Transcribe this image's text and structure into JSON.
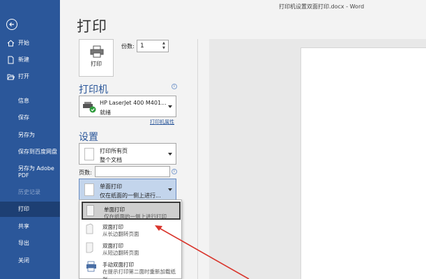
{
  "window": {
    "title": "打印机设置双面打印.docx  -  Word"
  },
  "sidebar": {
    "back_label": "",
    "items": [
      {
        "label": "开始"
      },
      {
        "label": "新建"
      },
      {
        "label": "打开"
      },
      {
        "label": "信息"
      },
      {
        "label": "保存"
      },
      {
        "label": "另存为"
      },
      {
        "label": "保存到百度网盘"
      },
      {
        "label_line1": "另存为 Adobe",
        "label_line2": "PDF"
      },
      {
        "label": "历史记录"
      },
      {
        "label": "打印"
      },
      {
        "label": "共享"
      },
      {
        "label": "导出"
      },
      {
        "label": "关闭"
      }
    ]
  },
  "main": {
    "title": "打印",
    "print_button": "打印",
    "copies_label": "份数:",
    "copies_value": "1",
    "printer_heading": "打印机",
    "printer_name": "HP LaserJet 400 M401...",
    "printer_status": "就绪",
    "printer_properties": "打印机属性",
    "settings_heading": "设置",
    "print_range_line1": "打印所有页",
    "print_range_line2": "整个文档",
    "pages_label": "页数:",
    "pages_value": "",
    "duplex_line1": "单面打印",
    "duplex_line2": "仅在纸面的一侧上进行...",
    "options": [
      {
        "t1": "单面打印",
        "t2": "仅在纸面的一侧上进行打印"
      },
      {
        "t1": "双面打印",
        "t2": "从长边翻转页面"
      },
      {
        "t1": "双面打印",
        "t2": "从短边翻转页面"
      },
      {
        "t1": "手动双面打印",
        "t2": "在提示打印第二面时重新加载纸张"
      }
    ]
  },
  "colors": {
    "accent": "#2b579a",
    "sidebar_active": "#1d3f73",
    "arrow": "#d9342b"
  }
}
